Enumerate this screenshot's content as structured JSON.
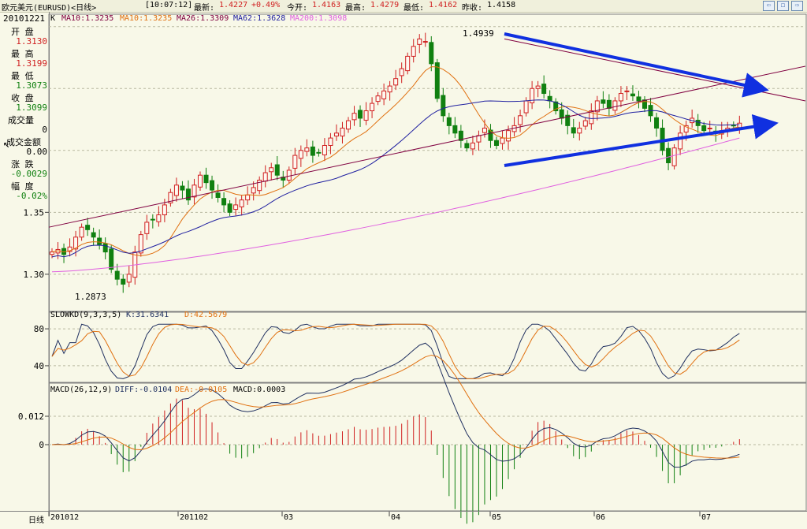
{
  "header": {
    "instrument": "欧元美元(EURUSD)<日线>",
    "time": "[10:07:12]",
    "latest_label": "最新:",
    "latest": "1.4227",
    "change": "+0.49%",
    "open_label": "今开:",
    "open": "1.4163",
    "high_label": "最高:",
    "high": "1.4279",
    "low_label": "最低:",
    "low": "1.4162",
    "prev_label": "昨收:",
    "prev": "1.4158"
  },
  "ma_legend": {
    "k": "K",
    "ma10a": "MA10:1.3235",
    "ma10b": "MA10:1.3235",
    "ma26": "MA26:1.3309",
    "ma62": "MA62:1.3628",
    "ma200": "MA200:1.3098"
  },
  "info": {
    "date": "20101221",
    "open_label": "开  盘",
    "open": "1.3130",
    "high_label": "最  高",
    "high": "1.3199",
    "low_label": "最  低",
    "low": "1.3073",
    "close_label": "收  盘",
    "close": "1.3099",
    "vol_label": "成交量",
    "vol": "0",
    "amt_label": "成交金额",
    "amt": "0.00",
    "chg_label": "涨  跌",
    "chg": "-0.0029",
    "pct_label": "幅  度",
    "pct": "-0.02%"
  },
  "indicator_labels": {
    "kd_name": "SLOWKD(9,3,3,5)",
    "kd_k": "K:31.6341",
    "kd_d": "D:42.5679",
    "macd_name": "MACD(26,12,9)",
    "macd_diff": "DIFF:-0.0104",
    "macd_dea": "DEA:-0.0105",
    "macd_val": "MACD:0.0003"
  },
  "annotations": {
    "peak": "1.4939",
    "trough": "1.2873"
  },
  "colors": {
    "up": "#d02020",
    "down": "#108010",
    "ma10": "#e07010",
    "ma26": "#800040",
    "ma62": "#2020a0",
    "ma200": "#e060e0",
    "trend": "#1030e0",
    "kline": "#203060"
  },
  "chart_data": [
    {
      "type": "candlestick",
      "title": "",
      "ylim": [
        1.27,
        1.51
      ],
      "yticks": [
        1.3,
        1.35
      ],
      "ytick_labels": [
        "1.30",
        "1.35"
      ],
      "x_labels": [
        "201012",
        "201102",
        "03",
        "04",
        "05",
        "06",
        "07"
      ],
      "annotations": [
        {
          "text": "1.4939",
          "value": 1.4939
        },
        {
          "text": "1.2873",
          "value": 1.2873
        }
      ],
      "series": [
        {
          "name": "MA10",
          "key": "ma10"
        },
        {
          "name": "MA26",
          "key": "ma26"
        },
        {
          "name": "MA62",
          "key": "ma62"
        },
        {
          "name": "MA200",
          "key": "ma200"
        }
      ],
      "trendlines": [
        {
          "from": [
            0.5,
            1.338
          ],
          "to": [
            116,
            1.47
          ]
        },
        {
          "from": [
            72,
            1.452
          ],
          "to": [
            116,
            1.376
          ]
        }
      ]
    },
    {
      "type": "line",
      "title": "",
      "ylim": [
        22,
        98
      ],
      "yticks": [
        40,
        80
      ],
      "ytick_labels": [
        "40",
        "80"
      ],
      "series": [
        {
          "name": "K",
          "key": "K"
        },
        {
          "name": "D",
          "key": "D"
        }
      ]
    },
    {
      "type": "bar",
      "title": "",
      "ylim": [
        -0.028,
        0.026
      ],
      "yticks": [
        0,
        0.012
      ],
      "ytick_labels": [
        "0",
        "0.012"
      ],
      "series": [
        {
          "name": "DIFF",
          "key": "diff"
        },
        {
          "name": "DEA",
          "key": "dea"
        },
        {
          "name": "MACD",
          "key": "hist"
        }
      ]
    }
  ]
}
